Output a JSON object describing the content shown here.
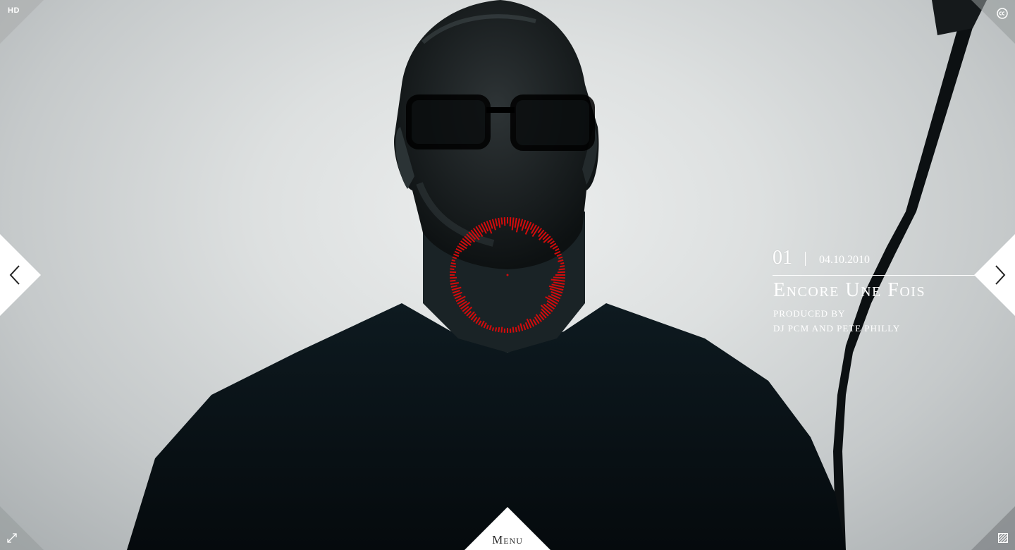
{
  "player": {
    "hd_label": "HD",
    "menu_label": "Menu",
    "icons": {
      "cc": "closed-captions-icon",
      "expand": "expand-icon",
      "grain": "grain-toggle-icon",
      "prev": "chevron-left-icon",
      "next": "chevron-right-icon"
    }
  },
  "track": {
    "number": "01",
    "date": "04.10.2010",
    "title": "Encore Une Fois",
    "credit_line1": "Produced by",
    "credit_line2": "DJ PCM and Pete Philly"
  },
  "visualizer": {
    "color": "#d40b0b",
    "bar_count": 120,
    "levels": [
      0.35,
      0.55,
      0.8,
      0.6,
      0.9,
      0.45,
      0.7,
      0.5,
      0.85,
      0.4,
      0.6,
      0.75,
      0.3,
      0.5,
      0.65,
      0.45,
      0.55,
      0.35,
      0.25,
      0.4,
      0.3,
      0.2,
      0.35,
      0.25,
      0.2,
      0.3,
      0.15,
      0.25,
      0.35,
      0.45,
      0.6,
      0.75,
      0.9,
      0.7,
      0.8,
      0.95,
      0.85,
      0.7,
      0.6,
      0.75,
      0.9,
      0.65,
      0.55,
      0.7,
      0.8,
      0.6,
      0.5,
      0.4,
      0.55,
      0.45,
      0.35,
      0.5,
      0.6,
      0.4,
      0.3,
      0.45,
      0.35,
      0.25,
      0.3,
      0.2,
      0.25,
      0.2,
      0.3,
      0.25,
      0.2,
      0.15,
      0.25,
      0.2,
      0.3,
      0.35,
      0.25,
      0.4,
      0.3,
      0.45,
      0.5,
      0.35,
      0.6,
      0.45,
      0.7,
      0.55,
      0.5,
      0.65,
      0.4,
      0.55,
      0.45,
      0.6,
      0.35,
      0.5,
      0.3,
      0.4,
      0.25,
      0.35,
      0.2,
      0.3,
      0.25,
      0.15,
      0.2,
      0.3,
      0.25,
      0.35,
      0.45,
      0.55,
      0.5,
      0.65,
      0.55,
      0.7,
      0.6,
      0.8,
      0.65,
      0.75,
      0.5,
      0.7,
      0.6,
      0.85,
      0.55,
      0.7,
      0.45,
      0.6,
      0.4,
      0.5
    ]
  }
}
